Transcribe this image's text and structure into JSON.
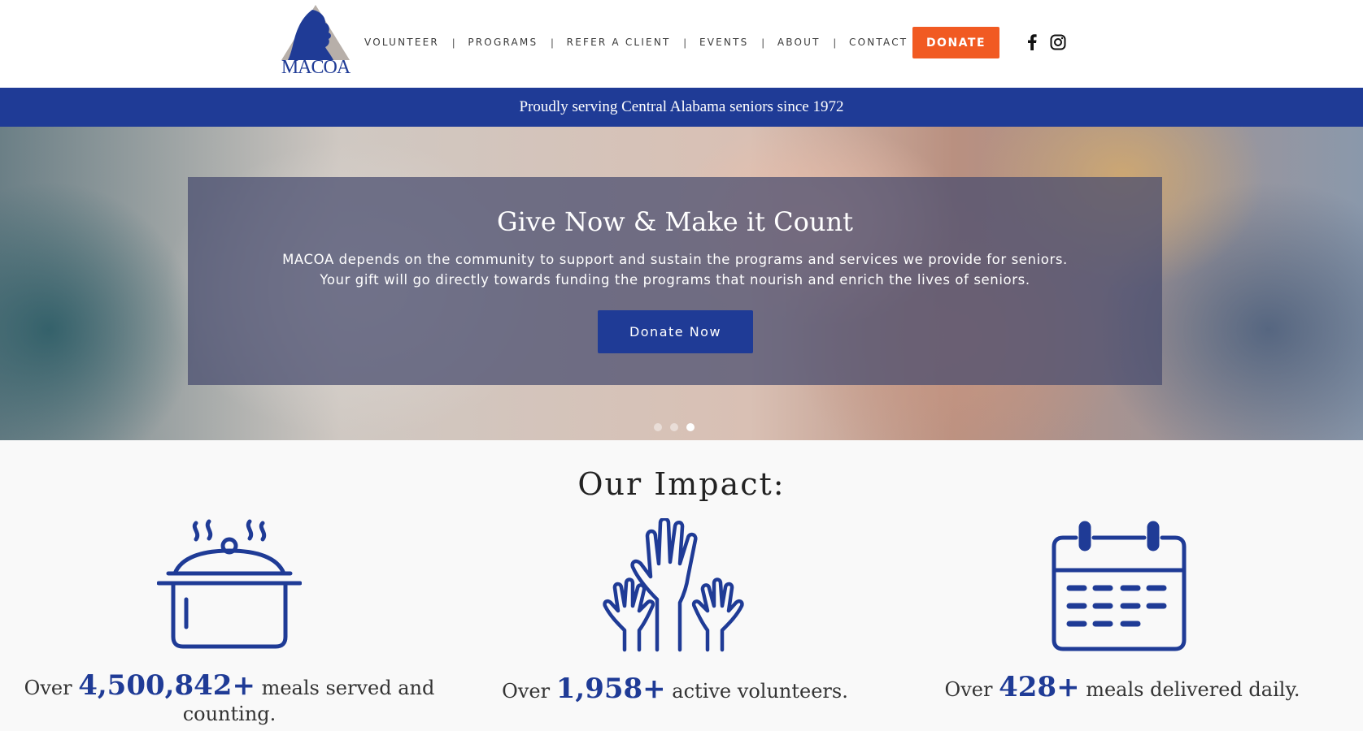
{
  "brand": {
    "name": "MACOA",
    "colors": {
      "primary": "#1f3b96",
      "accent": "#f15a22"
    }
  },
  "nav": {
    "items": [
      {
        "label": "VOLUNTEER"
      },
      {
        "label": "PROGRAMS"
      },
      {
        "label": "REFER A CLIENT"
      },
      {
        "label": "EVENTS"
      },
      {
        "label": "ABOUT"
      },
      {
        "label": "CONTACT"
      }
    ],
    "separator": "|",
    "donate_label": "DONATE",
    "social": [
      "facebook-icon",
      "instagram-icon"
    ]
  },
  "banner": {
    "text": "Proudly serving Central Alabama seniors since 1972"
  },
  "hero": {
    "title": "Give Now & Make it Count",
    "line1": "MACOA depends on the community to support and sustain the programs and services we provide for seniors.",
    "line2": "Your gift will go directly towards funding the programs that nourish and enrich the lives of seniors.",
    "button_label": "Donate Now",
    "carousel": {
      "slides": 3,
      "active": 3
    }
  },
  "impact": {
    "title": "Our Impact:",
    "stats": [
      {
        "icon": "cooking-pot-icon",
        "prefix": "Over ",
        "number": "4,500,842+",
        "suffix": " meals served and counting."
      },
      {
        "icon": "raised-hands-icon",
        "prefix": "Over ",
        "number": "1,958+",
        "suffix": " active volunteers."
      },
      {
        "icon": "calendar-icon",
        "prefix": "Over ",
        "number": "428+",
        "suffix": " meals delivered daily."
      }
    ]
  }
}
